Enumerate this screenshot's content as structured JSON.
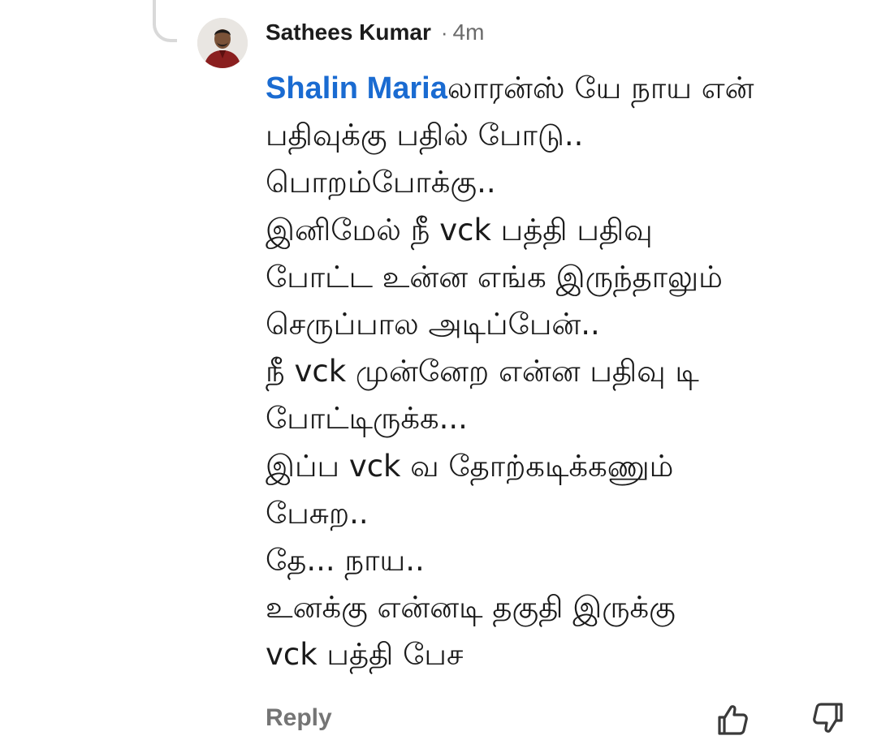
{
  "comment": {
    "author": "Sathees Kumar",
    "separator": "·",
    "time": "4m",
    "mention": "Shalin Maria",
    "first_line_text": "லாரன்ஸ் யே நாய என்",
    "lines": [
      "பதிவுக்கு பதில் போடு..",
      "பொறம்போக்கு..",
      "இனிமேல் நீ vck பத்தி பதிவு",
      "போட்ட உன்ன எங்க இருந்தாலும்",
      "செருப்பால அடிப்பேன்..",
      "நீ vck முன்னேற என்ன பதிவு டி",
      "போட்டிருக்க...",
      "இப்ப vck வ தோற்கடிக்கணும்",
      "பேசுற..",
      "தே... நாய..",
      "உனக்கு என்னடி தகுதி இருக்கு",
      "vck பத்தி பேச"
    ]
  },
  "actions": {
    "reply_label": "Reply",
    "like_icon": "thumbs-up-icon",
    "dislike_icon": "thumbs-down-icon"
  },
  "colors": {
    "mention": "#1a6bd1",
    "meta_gray": "#6b6b6b",
    "action_gray": "#757575"
  }
}
